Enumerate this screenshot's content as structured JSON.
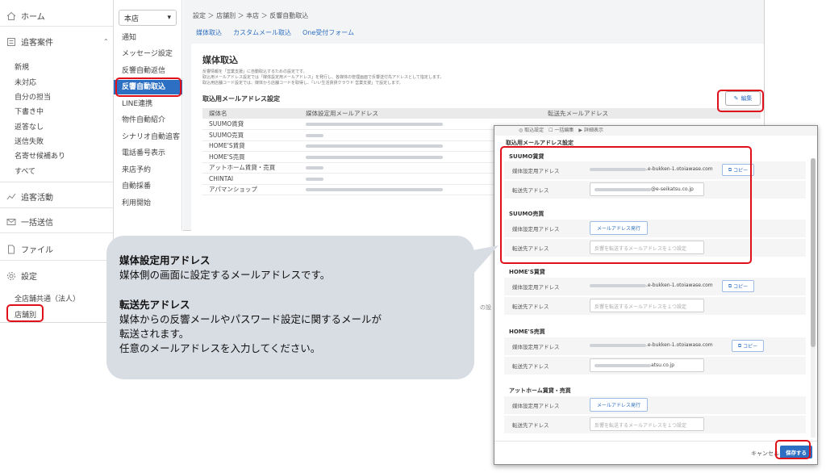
{
  "sidebar": {
    "home": "ホーム",
    "attraction": "追客案件",
    "items": [
      "新規",
      "未対応",
      "自分の担当",
      "下書き中",
      "返答なし",
      "送信失敗",
      "名寄せ候補あり",
      "すべて"
    ],
    "activity": "追客活動",
    "bulk": "一括送信",
    "file": "ファイル",
    "settings": "設定",
    "all_stores": "全店舗共通（法人）",
    "by_store": "店舗別"
  },
  "subnav": {
    "store_value": "本店",
    "items": [
      "通知",
      "メッセージ設定",
      "反響自動返信",
      "反響自動取込",
      "LINE連携",
      "物件自動紹介",
      "シナリオ自動追客",
      "電話番号表示",
      "来店予約",
      "自動採番",
      "利用開始"
    ]
  },
  "main": {
    "breadcrumb": "設定 ＞ 店舗別 ＞ 本店 ＞ 反響自動取込",
    "subtabs": [
      "媒体取込",
      "カスタムメール取込",
      "One受付フォーム"
    ],
    "title": "媒体取込",
    "desc": [
      "反響情報を「営業支援」に自動取込するための設定です。",
      "取込用メールアドレス設定では「媒体設定用メールアドレス」を発行し、各媒体の管理画面で反響送付先アドレスとして指定します。",
      "取込用店舗コード設定では、媒体から店舗コードを取得し、「いい生活賃貸クラウド 営業支援」で設定します。"
    ],
    "section_title": "取込用メールアドレス設定",
    "edit_label": "編集",
    "table_headers": [
      "媒体名",
      "媒体設定用メールアドレス",
      "転送先メールアドレス"
    ],
    "table_rows": [
      "SUUMO賃貸",
      "SUUMO売買",
      "HOME'S賃貸",
      "HOME'S売買",
      "アットホーム賃貸・売買",
      "CHINTAI",
      "アパマンショップ"
    ]
  },
  "modal": {
    "behind_text": "◎ 取込設定　☐ 一括編集　▶ 詳細表示",
    "title": "取込用メールアドレス設定",
    "label_media": "媒体設定用アドレス",
    "label_forward": "転送先アドレス",
    "copy_label": "コピー",
    "issue_label": "メールアドレス発行",
    "forward_placeholder": "反響を転送するメールアドレスを１つ設定",
    "sections": [
      {
        "name": "SUUMO賃貸",
        "media_email": ".e-bukken-1.otoiawase.com",
        "forward_email": "@e-seikatsu.co.jp"
      },
      {
        "name": "SUUMO売買"
      },
      {
        "name": "HOME'S賃貸",
        "media_email": ".e-bukken-1.otoiawase.com"
      },
      {
        "name": "HOME'S売買",
        "media_email": ".e-bukken-1.otoiawase.com",
        "forward_email": "atsu.co.jp"
      },
      {
        "name": "アットホーム賃貸・売買"
      }
    ],
    "cancel_label": "キャンセル",
    "save_label": "保存する"
  },
  "callout": {
    "head1": "媒体設定用アドレス",
    "text1": "媒体側の画面に設定するメールアドレスです。",
    "head2": "転送先アドレス",
    "text2a": "媒体からの反響メールやパスワード設定に関するメールが",
    "text2b": "転送されます。",
    "text2c": "任意のメールアドレスを入力してください。"
  },
  "colors": {
    "accent": "#2d6fc2",
    "highlight": "#e0101a",
    "callout_bg": "#d8dce3"
  }
}
